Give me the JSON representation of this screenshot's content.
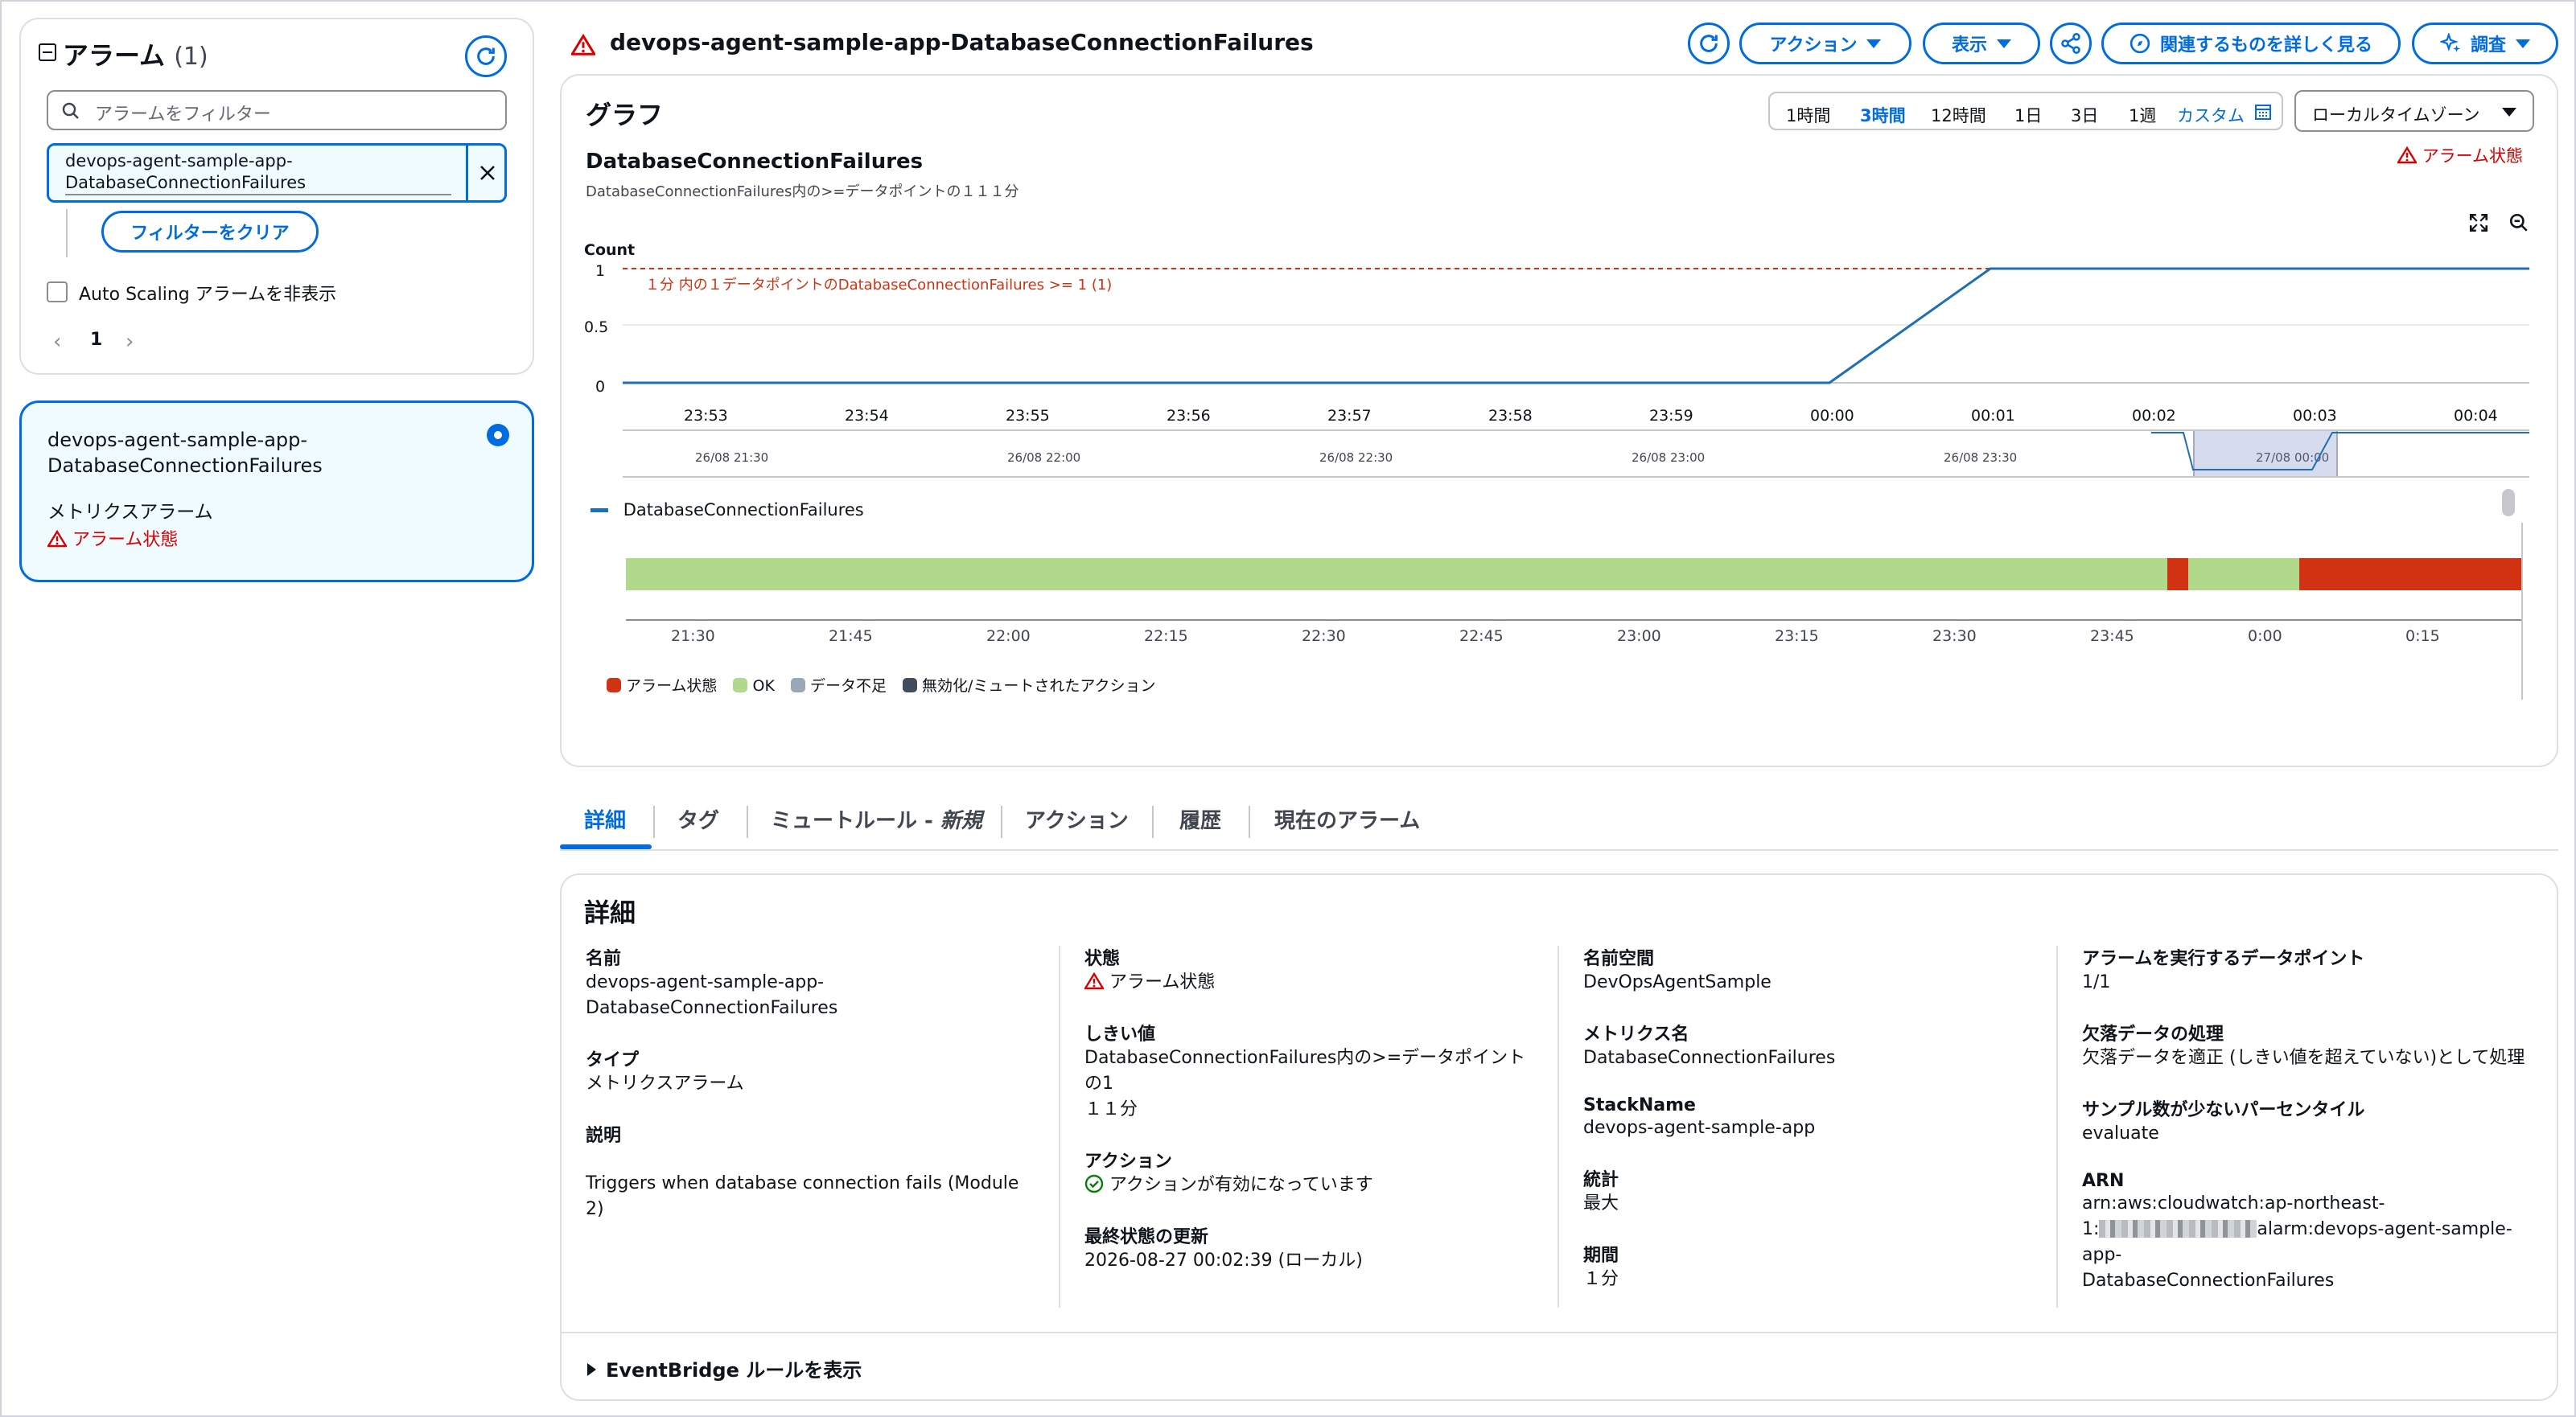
{
  "sidebar": {
    "title": "アラーム",
    "count": "(1)",
    "filter_placeholder": "アラームをフィルター",
    "filter_token_line1": "devops-agent-sample-app-",
    "filter_token_line2": "DatabaseConnectionFailures",
    "clear_filter_label": "フィルターをクリア",
    "hide_autoscaling_label": "Auto Scaling アラームを非表示",
    "page_number": "1",
    "alarm_card": {
      "name_line1": "devops-agent-sample-app-",
      "name_line2": "DatabaseConnectionFailures",
      "type": "メトリクスアラーム",
      "state": "アラーム状態"
    }
  },
  "header": {
    "alarm_name": "devops-agent-sample-app-DatabaseConnectionFailures",
    "actions_label": "アクション",
    "view_label": "表示",
    "explore_label": "関連するものを詳しく見る",
    "investigate_label": "調査"
  },
  "graph": {
    "section_title": "グラフ",
    "time_ranges": [
      "1時間",
      "3時間",
      "12時間",
      "1日",
      "3日",
      "1週"
    ],
    "selected_range": "3時間",
    "custom_label": "カスタム",
    "timezone": "ローカルタイムゾーン",
    "alarm_state": "アラーム状態",
    "metric_title": "DatabaseConnectionFailures",
    "metric_subtitle": "DatabaseConnectionFailures内の>=データポイントの１１１分",
    "y_unit": "Count",
    "threshold_label": "１分 内の１データポイントのDatabaseConnectionFailures >= 1 (1)",
    "y_ticks": [
      "1",
      "0.5",
      "0"
    ],
    "x_ticks": [
      "23:53",
      "23:54",
      "23:55",
      "23:56",
      "23:57",
      "23:58",
      "23:59",
      "00:00",
      "00:01",
      "00:02",
      "00:03",
      "00:04"
    ],
    "nav_ticks": [
      "26/08 21:30",
      "26/08 22:00",
      "26/08 22:30",
      "26/08 23:00",
      "26/08 23:30",
      "27/08 00:00"
    ],
    "legend_series": "DatabaseConnectionFailures",
    "timeline_ticks": [
      "21:30",
      "21:45",
      "22:00",
      "22:15",
      "22:30",
      "22:45",
      "23:00",
      "23:15",
      "23:30",
      "23:45",
      "0:00",
      "0:15"
    ],
    "state_legend": [
      "アラーム状態",
      "OK",
      "データ不足",
      "無効化/ミュートされたアクション"
    ],
    "colors": {
      "alarm": "#d13212",
      "ok": "#b0d98c",
      "insufficient": "#9ba7b6",
      "disabled": "#414d5c",
      "line": "#1f6fb5"
    }
  },
  "chart_data": {
    "type": "line",
    "x": [
      "23:53",
      "23:54",
      "23:55",
      "23:56",
      "23:57",
      "23:58",
      "23:59",
      "00:00",
      "00:01",
      "00:02",
      "00:03",
      "00:04"
    ],
    "series": [
      {
        "name": "DatabaseConnectionFailures",
        "values": [
          0,
          0,
          0,
          0,
          0,
          0,
          0,
          0,
          1,
          1,
          1,
          1
        ]
      }
    ],
    "threshold": 1,
    "ylabel": "Count",
    "ylim": [
      0,
      1
    ]
  },
  "tabs": [
    "詳細",
    "タグ",
    "ミュートルール - ",
    "アクション",
    "履歴",
    "現在のアラーム"
  ],
  "tab_new": "新規",
  "details": {
    "title": "詳細",
    "name_label": "名前",
    "name_line1": "devops-agent-sample-app-",
    "name_line2": "DatabaseConnectionFailures",
    "type_label": "タイプ",
    "type_value": "メトリクスアラーム",
    "desc_label": "説明",
    "desc_value": "Triggers when database connection fails (Module 2)",
    "state_label": "状態",
    "state_value": "アラーム状態",
    "threshold_label": "しきい値",
    "threshold_line1": "DatabaseConnectionFailures内の>=データポイントの1",
    "threshold_line2": "１１分",
    "actions_label": "アクション",
    "actions_value": "アクションが有効になっています",
    "updated_label": "最終状態の更新",
    "updated_value": "2026-08-27 00:02:39 (ローカル)",
    "namespace_label": "名前空間",
    "namespace_value": "DevOpsAgentSample",
    "metric_label": "メトリクス名",
    "metric_value": "DatabaseConnectionFailures",
    "stack_label": "StackName",
    "stack_value": "devops-agent-sample-app",
    "stat_label": "統計",
    "stat_value": "最大",
    "period_label": "期間",
    "period_value": "１分",
    "dp_label": "アラームを実行するデータポイント",
    "dp_value": "1/1",
    "missing_label": "欠落データの処理",
    "missing_value": "欠落データを適正 (しきい値を超えていない)として処理",
    "percentile_label": "サンプル数が少ないパーセンタイル",
    "percentile_value": "evaluate",
    "arn_label": "ARN",
    "arn_line1": "arn:aws:cloudwatch:ap-northeast-",
    "arn_line2_prefix": "1:",
    "arn_line2_suffix": "alarm:devops-agent-sample-app-",
    "arn_line3": "DatabaseConnectionFailures"
  },
  "eventbridge_label": "EventBridge ルールを表示"
}
